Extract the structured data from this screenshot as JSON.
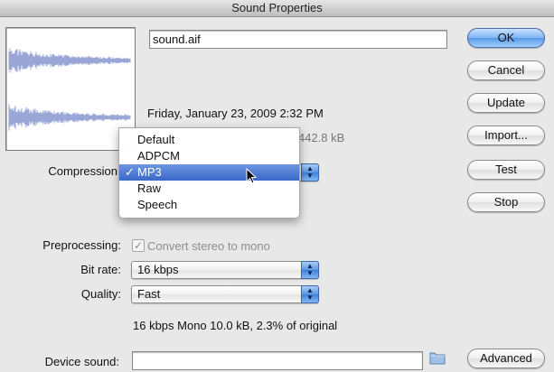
{
  "window": {
    "title": "Sound Properties"
  },
  "file": {
    "name": "sound.aif",
    "date": "Friday, January 23, 2009  2:32 PM",
    "info_partial": "442.8 kB"
  },
  "buttons": {
    "ok": "OK",
    "cancel": "Cancel",
    "update": "Update",
    "import": "Import...",
    "test": "Test",
    "stop": "Stop",
    "advanced": "Advanced"
  },
  "compression": {
    "label": "Compression",
    "options": [
      "Default",
      "ADPCM",
      "MP3",
      "Raw",
      "Speech"
    ],
    "selected": "MP3",
    "check": "✓"
  },
  "preprocessing": {
    "label": "Preprocessing:",
    "checkbox_label": "Convert stereo to mono",
    "checked": true
  },
  "bitrate": {
    "label": "Bit rate:",
    "value": "16 kbps"
  },
  "quality": {
    "label": "Quality:",
    "value": "Fast"
  },
  "summary": "16 kbps  Mono 10.0 kB, 2.3% of original",
  "device_sound": {
    "label": "Device sound:",
    "value": ""
  },
  "icons": {
    "folder": "folder-icon",
    "cursor": "cursor-icon",
    "waveform": "waveform-icon"
  },
  "colors": {
    "waveform": "#9aa6d6",
    "selection": "#3b68c8",
    "default_button": "#5a98e6"
  }
}
